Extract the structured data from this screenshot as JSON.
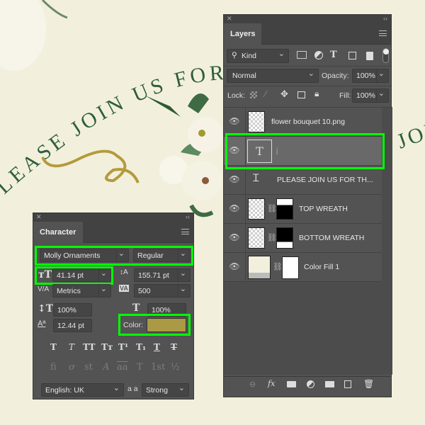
{
  "canvas": {
    "headline_left": "PLEASE JOIN US FOR",
    "headline_right": "JOIN",
    "background": "#f2f0dc",
    "text_color": "#2d5e3e",
    "swirl_color": "#b49a3c"
  },
  "layers_panel": {
    "tab": "Layers",
    "filter": {
      "value": "Kind",
      "icons": [
        "image-filter-icon",
        "adjustment-filter-icon",
        "type-filter-icon",
        "shape-filter-icon",
        "smart-object-filter-icon",
        "filter-toggle"
      ]
    },
    "blend_mode": "Normal",
    "opacity_label": "Opacity:",
    "opacity": "100%",
    "lock_label": "Lock:",
    "fill_label": "Fill:",
    "fill": "100%",
    "layers": [
      {
        "name": "flower bouquet 10.png",
        "type": "smart-object",
        "visible": true
      },
      {
        "name": "j",
        "type": "text",
        "visible": true,
        "selected": true
      },
      {
        "name": "PLEASE JOIN US FOR TH...",
        "type": "warped-text",
        "visible": true
      },
      {
        "name": "TOP WREATH",
        "type": "smart-object-with-mask",
        "visible": true
      },
      {
        "name": "BOTTOM WREATH",
        "type": "smart-object-with-mask",
        "visible": true
      },
      {
        "name": "Color Fill 1",
        "type": "fill-with-mask",
        "visible": true
      }
    ],
    "footer_icons": [
      "link-layers-icon",
      "fx-icon",
      "add-mask-icon",
      "adjustment-layer-icon",
      "group-folder-icon",
      "new-layer-icon",
      "trash-icon"
    ]
  },
  "character_panel": {
    "tab": "Character",
    "font_family": "Molly Ornaments",
    "font_style": "Regular",
    "font_size": "41.14 pt",
    "leading": "155.71 pt",
    "kerning": "Metrics",
    "tracking": "500",
    "vertical_scale": "100%",
    "horizontal_scale": "100%",
    "baseline_shift": "12.44 pt",
    "color_label": "Color:",
    "color": "#ab9a45",
    "language": "English: UK",
    "antialias_label": "a a",
    "antialias": "Strong",
    "style_buttons": [
      "T",
      "T",
      "TT",
      "Tт",
      "T¹",
      "T₁",
      "T",
      "T"
    ],
    "opentype_buttons": [
      "fi",
      "ơ",
      "st",
      "A",
      "aa",
      "T",
      "1st",
      "½"
    ]
  }
}
